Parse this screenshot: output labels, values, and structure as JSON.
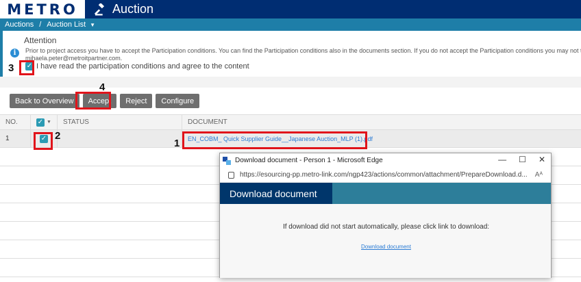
{
  "header": {
    "logo": "METRO",
    "app_title": "Auction"
  },
  "breadcrumb": {
    "item1": "Auctions",
    "separator": "/",
    "item2": "Auction List"
  },
  "attention": {
    "title": "Attention",
    "text": "Prior to project access you have to accept the Participation conditions. You can find the Participation conditions also in the documents section. If you do not accept the Participation conditions you may not take",
    "email": "mihaela.peter@metroitpartner.com.",
    "agree_label": "I have read the participation conditions and agree to the content"
  },
  "toolbar": {
    "back_label": "Back to Overview",
    "accept_label": "Accept",
    "reject_label": "Reject",
    "configure_label": "Configure"
  },
  "table": {
    "headers": {
      "no": "NO.",
      "status": "STATUS",
      "document": "DOCUMENT"
    },
    "rows": [
      {
        "no": "1",
        "status": "",
        "document": "EN_COBM_ Quick Supplier Guide__Japanese Auction_MLP (1).pdf"
      }
    ]
  },
  "annotations": {
    "n1": "1",
    "n2": "2",
    "n3": "3",
    "n4": "4"
  },
  "popup": {
    "window_title": "Download document - Person 1 - Microsoft Edge",
    "url": "https://esourcing-pp.metro-link.com/ngp423/actions/common/attachment/PrepareDownload.d...",
    "header_title": "Download document",
    "message": "If download did not start automatically, please click link to download:",
    "link_label": "Download document"
  },
  "colors": {
    "brand_dark": "#002d72",
    "brand_teal": "#1e7ea8",
    "checkbox": "#2b9bb4",
    "annotation_red": "#e1141b"
  }
}
